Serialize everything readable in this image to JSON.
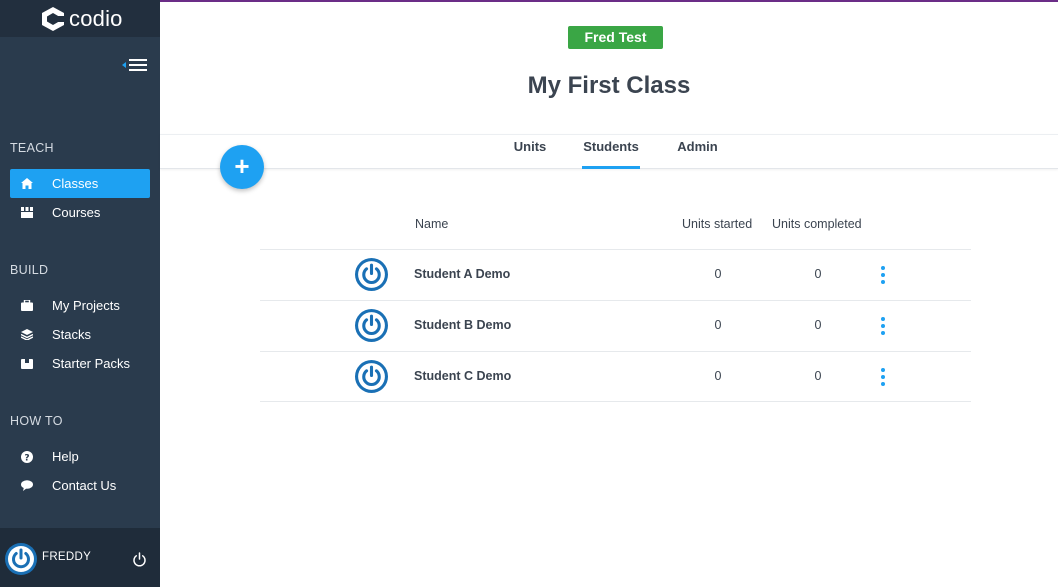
{
  "brand": {
    "name": "codio"
  },
  "sidebar": {
    "sections": [
      {
        "label": "TEACH",
        "items": [
          {
            "label": "Classes",
            "icon": "home-icon",
            "active": true
          },
          {
            "label": "Courses",
            "icon": "courses-icon"
          }
        ]
      },
      {
        "label": "BUILD",
        "items": [
          {
            "label": "My Projects",
            "icon": "briefcase-icon"
          },
          {
            "label": "Stacks",
            "icon": "layers-icon"
          },
          {
            "label": "Starter Packs",
            "icon": "box-icon"
          }
        ]
      },
      {
        "label": "HOW TO",
        "items": [
          {
            "label": "Help",
            "icon": "question-icon"
          },
          {
            "label": "Contact Us",
            "icon": "chat-bubble-icon"
          }
        ]
      }
    ],
    "user": {
      "name": "FREDDY"
    }
  },
  "header": {
    "user_badge": "Fred Test",
    "title": "My First Class"
  },
  "tabs": [
    {
      "label": "Units"
    },
    {
      "label": "Students",
      "active": true
    },
    {
      "label": "Admin"
    }
  ],
  "table": {
    "columns": [
      "Name",
      "Units started",
      "Units completed"
    ],
    "rows": [
      {
        "name": "Student A Demo",
        "started": "0",
        "completed": "0"
      },
      {
        "name": "Student B Demo",
        "started": "0",
        "completed": "0"
      },
      {
        "name": "Student C Demo",
        "started": "0",
        "completed": "0"
      }
    ]
  },
  "colors": {
    "accent": "#1ea1f2",
    "sidebar": "#2a3b4d",
    "badge": "#3aa645",
    "topline": "#6b2d87",
    "avatar": "#1a70b5"
  }
}
